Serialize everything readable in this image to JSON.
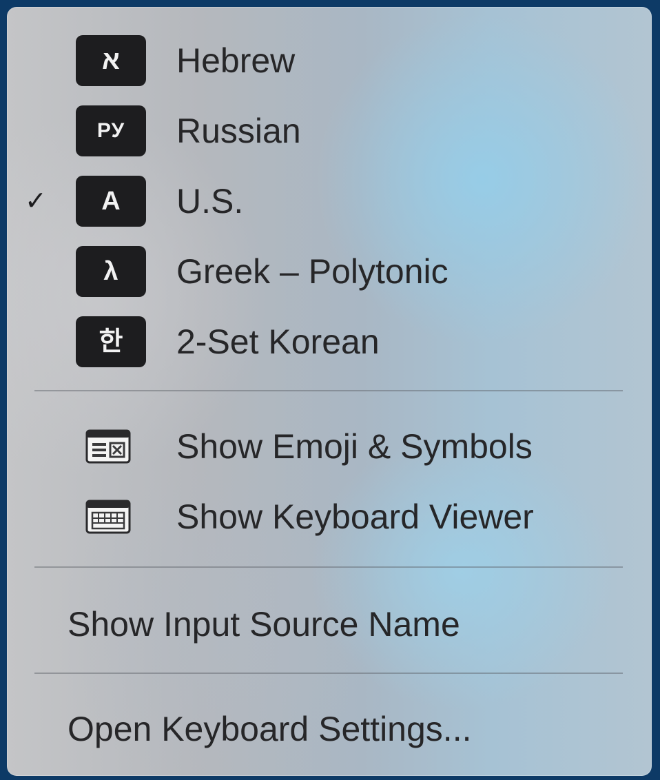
{
  "input_sources": [
    {
      "badge": "א",
      "label": "Hebrew",
      "icon": "hebrew-alef-icon",
      "checked": false
    },
    {
      "badge": "РУ",
      "label": "Russian",
      "icon": "russian-ru-icon",
      "checked": false
    },
    {
      "badge": "A",
      "label": "U.S.",
      "icon": "us-a-icon",
      "checked": true
    },
    {
      "badge": "λ",
      "label": "Greek – Polytonic",
      "icon": "greek-lambda-icon",
      "checked": false
    },
    {
      "badge": "한",
      "label": "2-Set Korean",
      "icon": "korean-han-icon",
      "checked": false
    }
  ],
  "checkmark": "✓",
  "viewers": [
    {
      "label": "Show Emoji & Symbols",
      "icon": "emoji-symbols-window-icon"
    },
    {
      "label": "Show Keyboard Viewer",
      "icon": "keyboard-viewer-window-icon"
    }
  ],
  "show_input_source_name": "Show Input Source Name",
  "open_keyboard_settings": "Open Keyboard Settings...",
  "colors": {
    "menu_text": "#262628",
    "badge_background": "#1d1d1f",
    "badge_text": "#f2f2f2",
    "desktop_background": "#0d3a66"
  }
}
